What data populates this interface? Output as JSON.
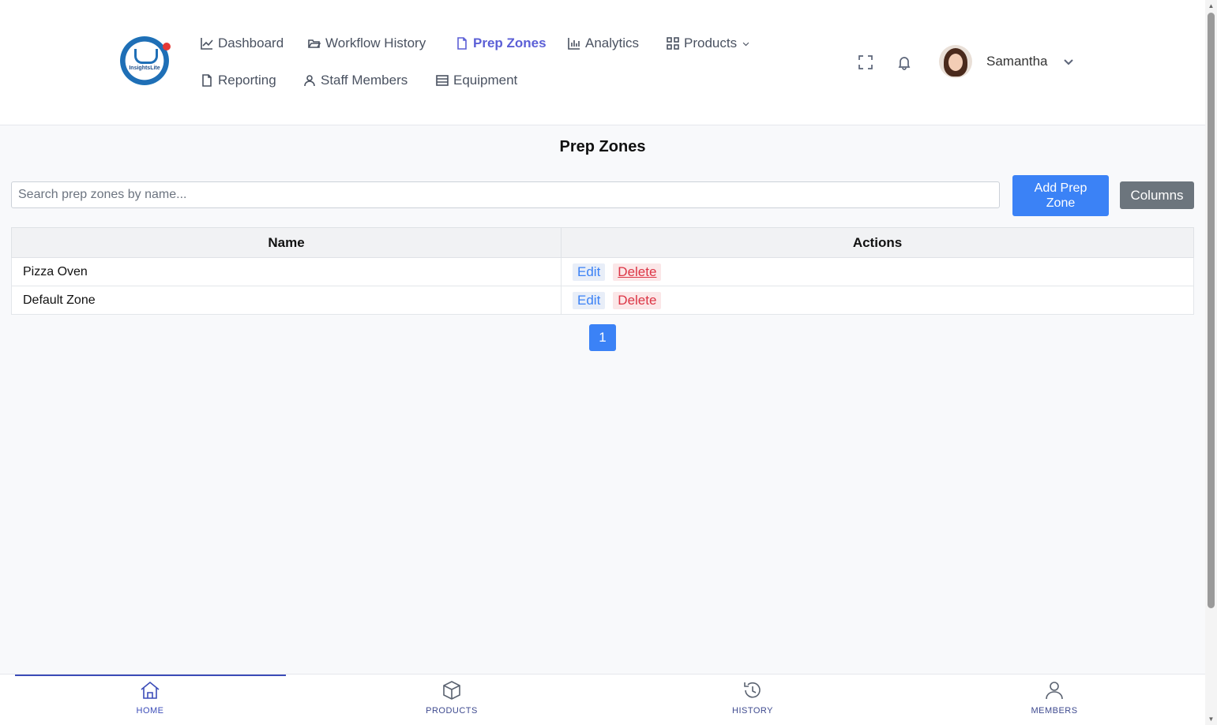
{
  "brand": {
    "logo_text": "InsightsLite"
  },
  "nav": {
    "items": [
      {
        "label": "Dashboard",
        "icon": "chart-line-icon"
      },
      {
        "label": "Workflow History",
        "icon": "folder-open-icon"
      },
      {
        "label": "Prep Zones",
        "icon": "file-icon",
        "active": true
      },
      {
        "label": "Analytics",
        "icon": "bar-chart-icon"
      },
      {
        "label": "Products",
        "icon": "grid-icon"
      },
      {
        "label": "Reporting",
        "icon": "file-icon"
      },
      {
        "label": "Staff Members",
        "icon": "user-icon"
      },
      {
        "label": "Equipment",
        "icon": "list-icon"
      }
    ]
  },
  "header": {
    "username": "Samantha"
  },
  "main": {
    "title": "Prep Zones",
    "search_placeholder": "Search prep zones by name...",
    "add_button": "Add Prep Zone",
    "columns_button": "Columns",
    "table": {
      "headers": [
        "Name",
        "Actions"
      ],
      "rows": [
        {
          "name": "Pizza Oven",
          "edit": "Edit",
          "delete": "Delete"
        },
        {
          "name": "Default Zone",
          "edit": "Edit",
          "delete": "Delete"
        }
      ]
    },
    "pagination": {
      "current": "1"
    }
  },
  "bottom_nav": {
    "items": [
      {
        "label": "HOME",
        "icon": "home-icon",
        "active": true
      },
      {
        "label": "PRODUCTS",
        "icon": "box-icon"
      },
      {
        "label": "HISTORY",
        "icon": "history-icon"
      },
      {
        "label": "MEMBERS",
        "icon": "user-icon"
      }
    ]
  },
  "colors": {
    "accent": "#3b82f6",
    "active_nav": "#5b5fd6",
    "danger": "#dc3545",
    "secondary": "#6c757d"
  }
}
